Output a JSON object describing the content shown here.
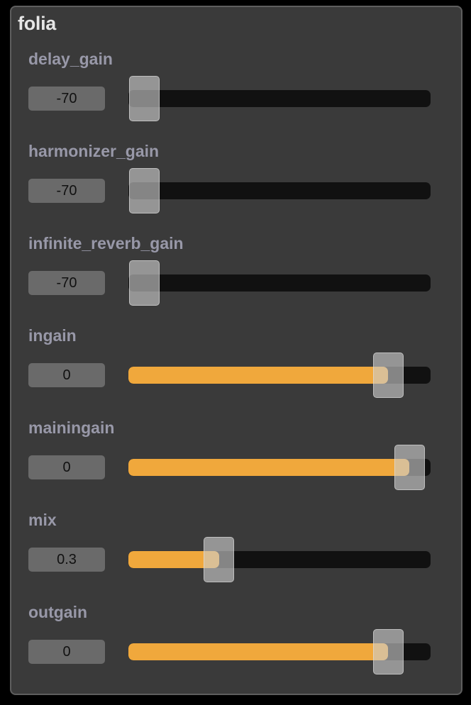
{
  "panel": {
    "title": "folia"
  },
  "sliders": [
    {
      "label": "delay_gain",
      "value": "-70",
      "level": 0.0
    },
    {
      "label": "harmonizer_gain",
      "value": "-70",
      "level": 0.0
    },
    {
      "label": "infinite_reverb_gain",
      "value": "-70",
      "level": 0.0
    },
    {
      "label": "ingain",
      "value": "0",
      "level": 0.86
    },
    {
      "label": "mainingain",
      "value": "0",
      "level": 0.93
    },
    {
      "label": "mix",
      "value": "0.3",
      "level": 0.3
    },
    {
      "label": "outgain",
      "value": "0",
      "level": 0.86
    }
  ],
  "colors": {
    "accent": "#f0a83c",
    "track": "#111111",
    "panel_bg": "#3a3a3a",
    "label": "#9898a8"
  }
}
